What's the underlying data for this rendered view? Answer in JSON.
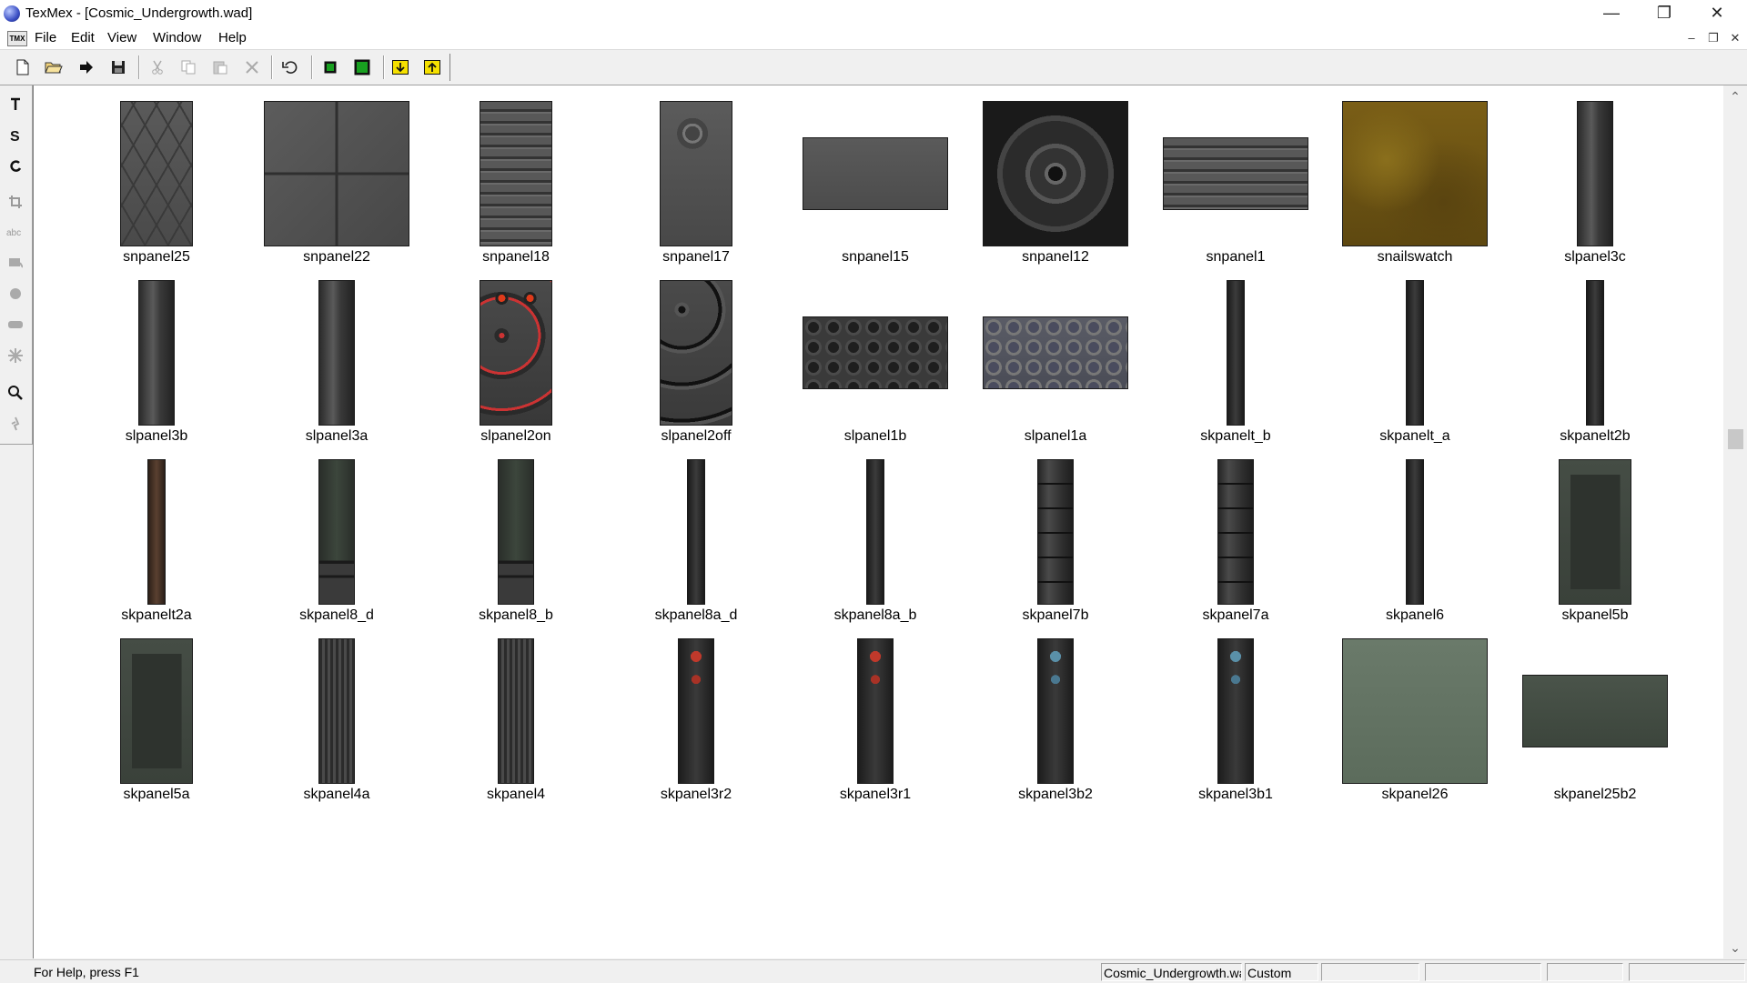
{
  "window": {
    "title": "TexMex - [Cosmic_Undergrowth.wad]"
  },
  "menu": {
    "items": [
      "File",
      "Edit",
      "View",
      "Window",
      "Help"
    ]
  },
  "textures": [
    {
      "name": "snpanel25",
      "w": 80,
      "h": 160,
      "shape": "hex"
    },
    {
      "name": "snpanel22",
      "w": 160,
      "h": 160,
      "shape": "quad"
    },
    {
      "name": "snpanel18",
      "w": 80,
      "h": 160,
      "shape": "rows"
    },
    {
      "name": "snpanel17",
      "w": 80,
      "h": 160,
      "shape": "ring"
    },
    {
      "name": "snpanel15",
      "w": 160,
      "h": 80,
      "shape": "plain"
    },
    {
      "name": "snpanel12",
      "w": 160,
      "h": 160,
      "shape": "wheel"
    },
    {
      "name": "snpanel1",
      "w": 160,
      "h": 80,
      "shape": "rows"
    },
    {
      "name": "snailswatch",
      "w": 160,
      "h": 160,
      "shape": "mud"
    },
    {
      "name": "slpanel3c",
      "w": 40,
      "h": 160,
      "shape": "strip"
    },
    {
      "name": "slpanel3b",
      "w": 40,
      "h": 160,
      "shape": "strip"
    },
    {
      "name": "slpanel3a",
      "w": 40,
      "h": 160,
      "shape": "strip"
    },
    {
      "name": "slpanel2on",
      "w": 80,
      "h": 160,
      "shape": "dotson"
    },
    {
      "name": "slpanel2off",
      "w": 80,
      "h": 160,
      "shape": "dotsoff"
    },
    {
      "name": "slpanel1b",
      "w": 160,
      "h": 80,
      "shape": "circles"
    },
    {
      "name": "slpanel1a",
      "w": 160,
      "h": 80,
      "shape": "circles2"
    },
    {
      "name": "skpanelt_b",
      "w": 20,
      "h": 160,
      "shape": "thin"
    },
    {
      "name": "skpanelt_a",
      "w": 20,
      "h": 160,
      "shape": "thin"
    },
    {
      "name": "skpanelt2b",
      "w": 20,
      "h": 160,
      "shape": "thin"
    },
    {
      "name": "skpanelt2a",
      "w": 20,
      "h": 160,
      "shape": "rust"
    },
    {
      "name": "skpanel8_d",
      "w": 40,
      "h": 160,
      "shape": "panel"
    },
    {
      "name": "skpanel8_b",
      "w": 40,
      "h": 160,
      "shape": "panel"
    },
    {
      "name": "skpanel8a_d",
      "w": 20,
      "h": 160,
      "shape": "thin"
    },
    {
      "name": "skpanel8a_b",
      "w": 20,
      "h": 160,
      "shape": "thin"
    },
    {
      "name": "skpanel7b",
      "w": 40,
      "h": 160,
      "shape": "tech"
    },
    {
      "name": "skpanel7a",
      "w": 40,
      "h": 160,
      "shape": "tech"
    },
    {
      "name": "skpanel6",
      "w": 20,
      "h": 160,
      "shape": "thin"
    },
    {
      "name": "skpanel5b",
      "w": 80,
      "h": 160,
      "shape": "frame"
    },
    {
      "name": "skpanel5a",
      "w": 80,
      "h": 160,
      "shape": "frame"
    },
    {
      "name": "skpanel4a",
      "w": 40,
      "h": 160,
      "shape": "ribbed"
    },
    {
      "name": "skpanel4",
      "w": 40,
      "h": 160,
      "shape": "ribbed"
    },
    {
      "name": "skpanel3r2",
      "w": 40,
      "h": 160,
      "shape": "red"
    },
    {
      "name": "skpanel3r1",
      "w": 40,
      "h": 160,
      "shape": "red"
    },
    {
      "name": "skpanel3b2",
      "w": 40,
      "h": 160,
      "shape": "blue"
    },
    {
      "name": "skpanel3b1",
      "w": 40,
      "h": 160,
      "shape": "blue"
    },
    {
      "name": "skpanel26",
      "w": 160,
      "h": 160,
      "shape": "green"
    },
    {
      "name": "skpanel25b2",
      "w": 160,
      "h": 80,
      "shape": "greenwide"
    }
  ],
  "status": {
    "help": "For Help, press F1",
    "file": "Cosmic_Undergrowth.wad",
    "mode": "Custom"
  }
}
